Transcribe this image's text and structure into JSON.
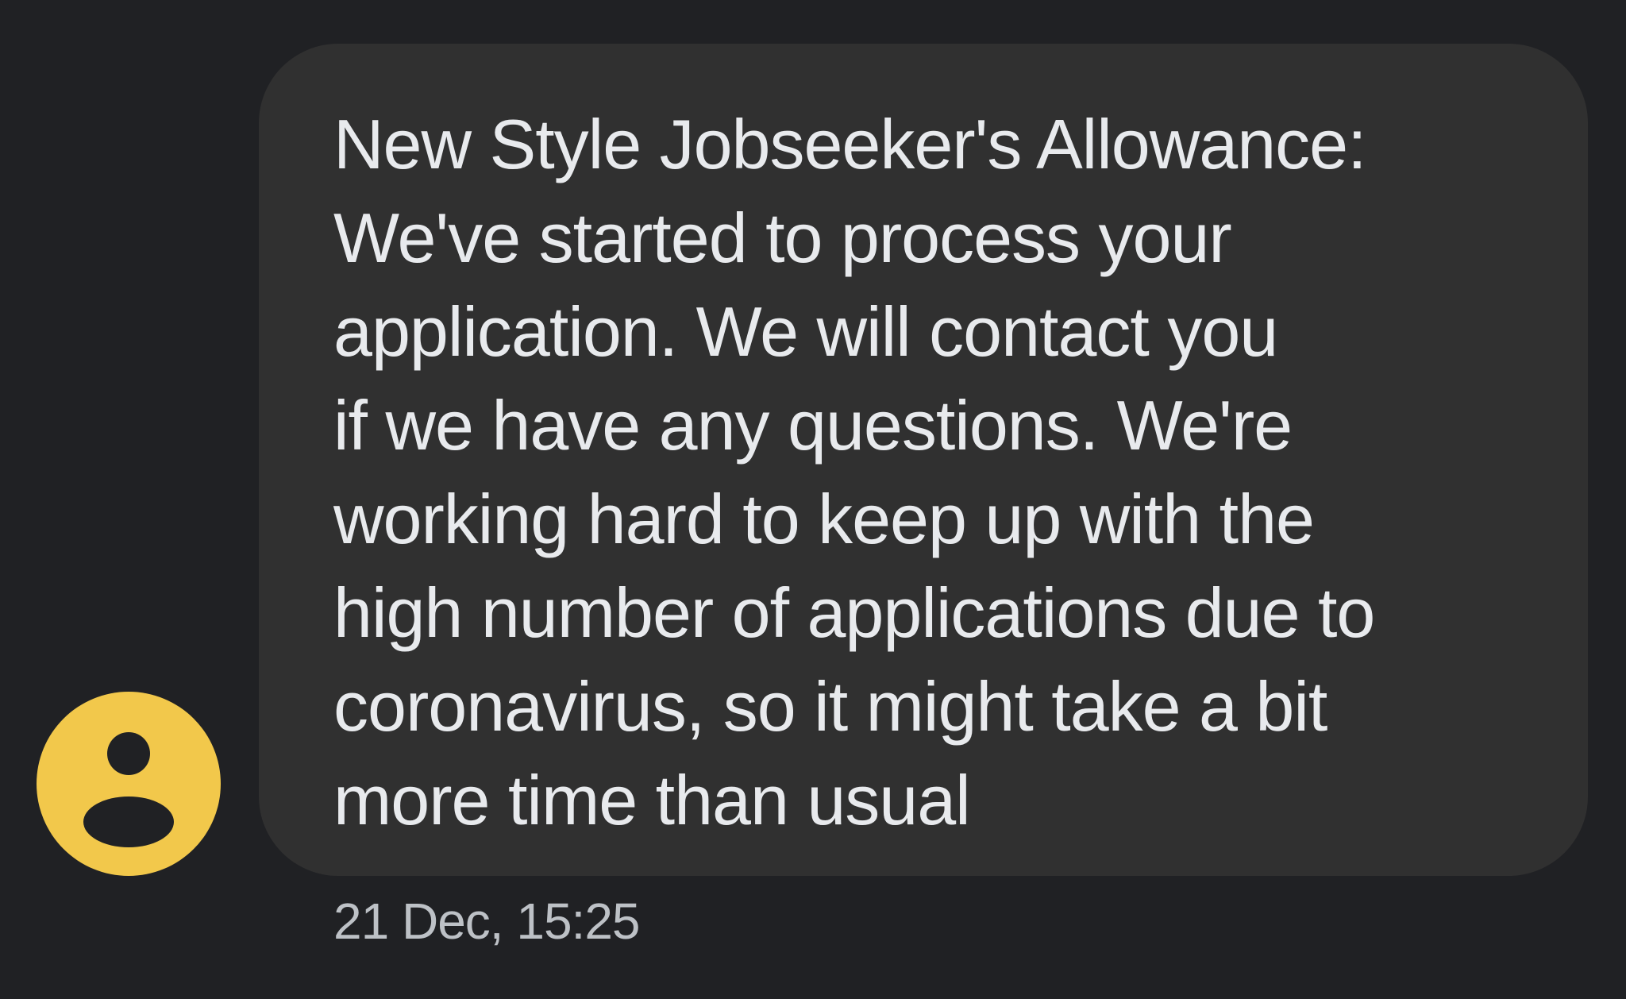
{
  "avatar": {
    "icon": "person-icon",
    "color": "#f2c84b"
  },
  "message": {
    "lines": [
      "New Style Jobseeker's Allowance:",
      "We've started to process your",
      "application. We will contact you",
      "if we have any questions. We're",
      "working hard to keep up with the",
      "high number of applications due to",
      "coronavirus, so it might take a bit",
      "more time than usual"
    ],
    "timestamp": "21 Dec, 15:25"
  },
  "colors": {
    "background": "#202124",
    "bubble": "#303030",
    "text": "#e8eaed",
    "timestamp": "#bdc1c6"
  }
}
